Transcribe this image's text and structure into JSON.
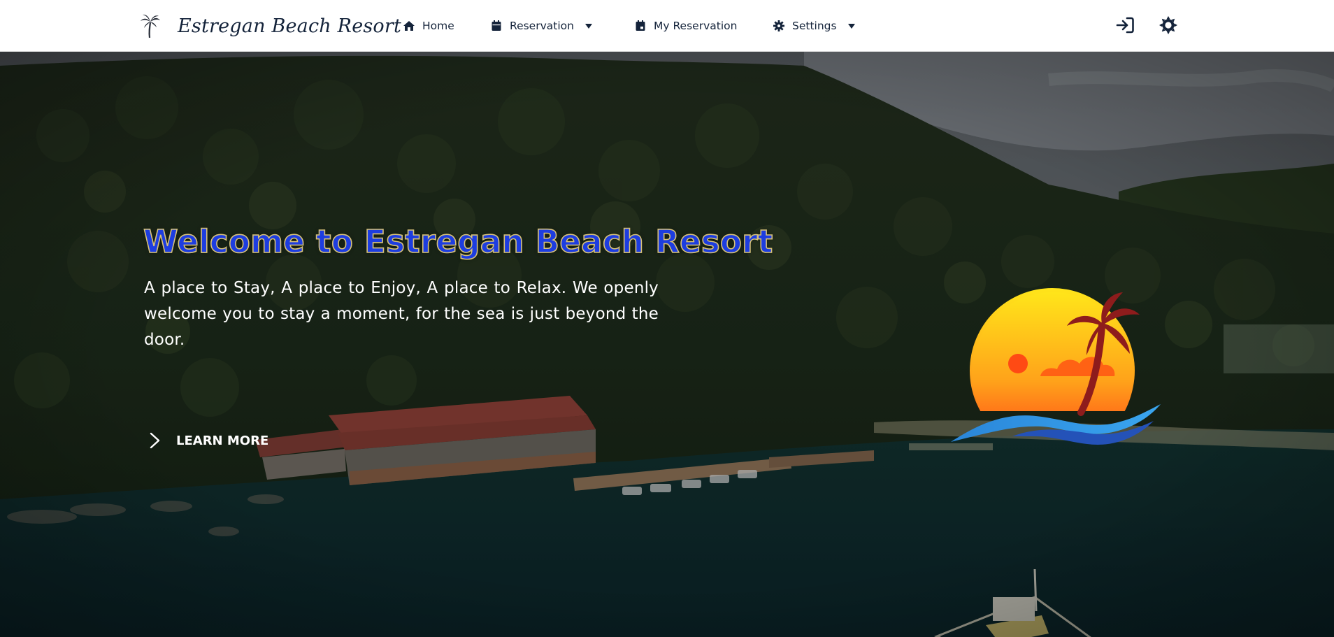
{
  "navbar": {
    "brand_name": "Estregan Beach Resort",
    "items": [
      {
        "label": "Home",
        "icon": "home-icon",
        "dropdown": false
      },
      {
        "label": "Reservation",
        "icon": "calendar-icon",
        "dropdown": true
      },
      {
        "label": "My Reservation",
        "icon": "calendar-check-icon",
        "dropdown": false
      },
      {
        "label": "Settings",
        "icon": "gear-icon",
        "dropdown": true
      }
    ],
    "right_icons": [
      "login-icon",
      "theme-toggle-icon"
    ]
  },
  "hero": {
    "title": "Welcome to Estregan Beach Resort",
    "description": "A place to Stay, A place to Enjoy, A place to Relax. We openly welcome you to stay a moment, for the sea is just beyond the door.",
    "cta_label": "LEARN MORE"
  },
  "colors": {
    "navbar_bg": "#ffffff",
    "nav_text": "#14233a",
    "title_fill": "#1d3de0",
    "title_outline": "#d7c27a",
    "hero_text": "#ffffff"
  }
}
